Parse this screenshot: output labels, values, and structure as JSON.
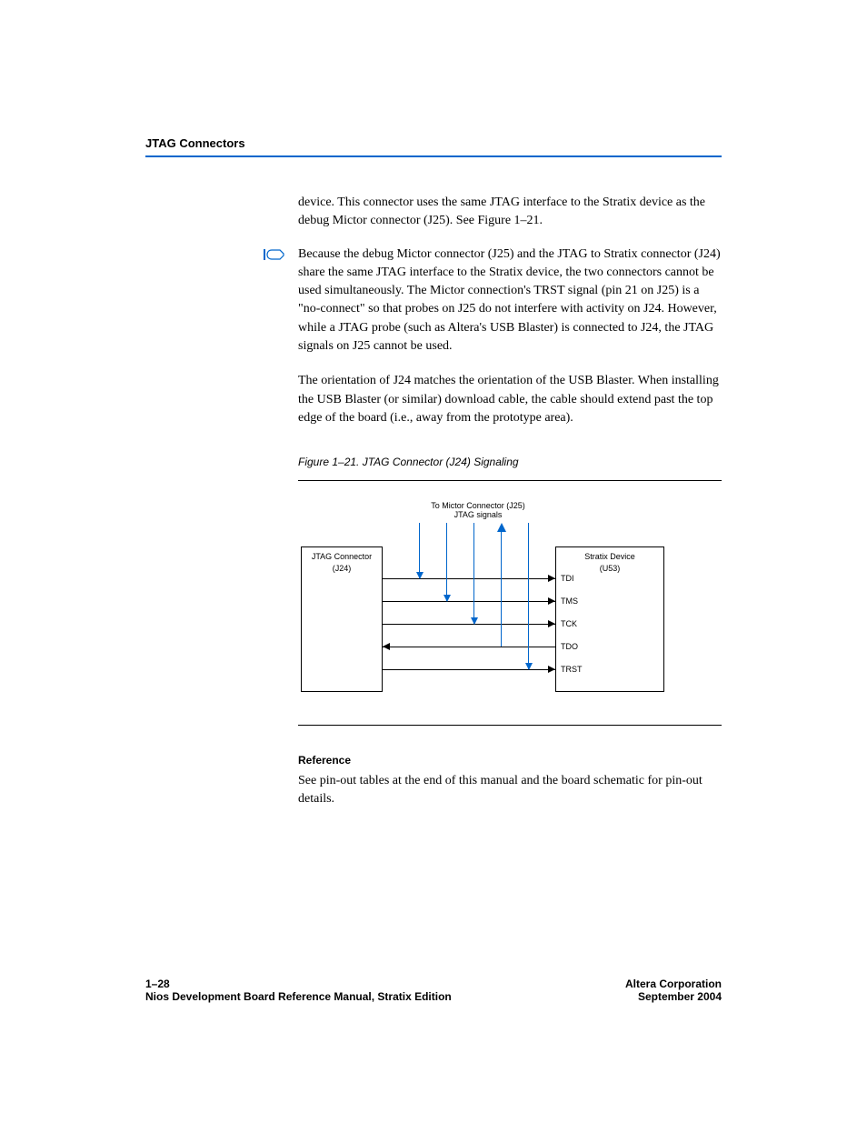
{
  "header": {
    "section": "JTAG Connectors"
  },
  "content": {
    "para1": "device. This connector uses the same JTAG interface to the Stratix device as the debug Mictor connector (J25). See Figure 1–21.",
    "note": "Because the debug Mictor connector (J25) and the JTAG to Stratix connector (J24) share the same JTAG interface to the Stratix device, the two connectors cannot be used simultaneously. The Mictor connection's TRST signal (pin 21 on J25) is a \"no-connect\" so that probes on J25 do not interfere with activity on J24. However, while a JTAG probe (such as Altera's USB Blaster) is connected to J24, the JTAG signals on J25 cannot be used.",
    "para2": "The orientation of J24 matches the orientation of the USB Blaster. When installing the USB Blaster (or similar) download cable, the cable should extend past the top edge of the board (i.e., away from the prototype area)."
  },
  "figure": {
    "title": "Figure 1–21. JTAG Connector (J24) Signaling",
    "mictor_label_line1": "To Mictor Connector (J25)",
    "mictor_label_line2": "JTAG signals",
    "jtag_box_line1": "JTAG Connector",
    "jtag_box_line2": "(J24)",
    "stratix_box_line1": "Stratix Device",
    "stratix_box_line2": "(U53)",
    "signals": [
      "TDI",
      "TMS",
      "TCK",
      "TDO",
      "TRST"
    ]
  },
  "reference": {
    "heading": "Reference",
    "body": "See pin-out tables at the end of this manual and the board schematic for pin-out details."
  },
  "footer": {
    "page_number": "1–28",
    "doc_title": "Nios Development Board Reference Manual, Stratix Edition",
    "company": "Altera Corporation",
    "date": "September 2004"
  }
}
